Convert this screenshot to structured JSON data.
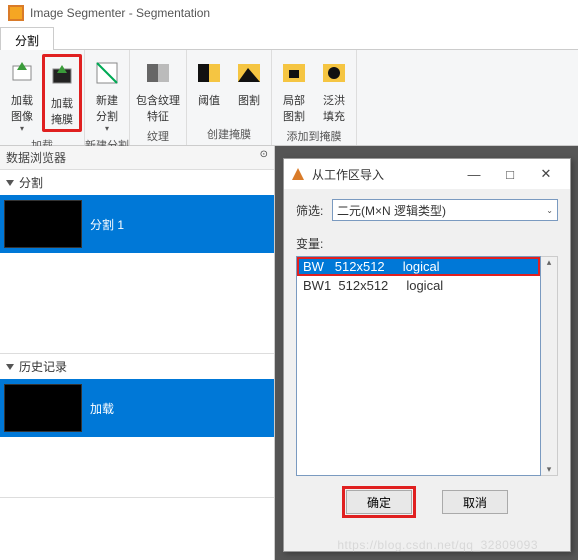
{
  "window": {
    "title": "Image Segmenter - Segmentation"
  },
  "tabstrip": {
    "tab1": "分割"
  },
  "ribbon": {
    "load_image": "加载\n图像",
    "load_mask": "加载\n掩膜",
    "new_seg": "新建\n分割",
    "texture": "包含纹理\n特征",
    "threshold": "阈值",
    "graphcut": "图割",
    "local_graphcut": "局部\n图割",
    "flood": "泛洪\n填充",
    "grp_load": "加载",
    "grp_newseg": "新建分割",
    "grp_texture": "纹理",
    "grp_create": "创建掩膜",
    "grp_addmask": "添加到掩膜"
  },
  "leftpanel": {
    "browser": "数据浏览器",
    "seg_section": "分割",
    "seg_item1": "分割 1",
    "history_section": "历史记录",
    "history_item1": "加载"
  },
  "dialog": {
    "title": "从工作区导入",
    "min_btn": "—",
    "max_btn": "□",
    "close_btn": "✕",
    "filter_label": "筛选:",
    "filter_value": "二元(M×N 逻辑类型)",
    "var_label": "变量:",
    "vars": [
      {
        "name": "BW",
        "size": "512x512",
        "type": "logical",
        "selected": true,
        "highlighted": true
      },
      {
        "name": "BW1",
        "size": "512x512",
        "type": "logical",
        "selected": false,
        "highlighted": false
      }
    ],
    "ok": "确定",
    "cancel": "取消"
  },
  "watermark": "https://blog.csdn.net/qq_32809093"
}
